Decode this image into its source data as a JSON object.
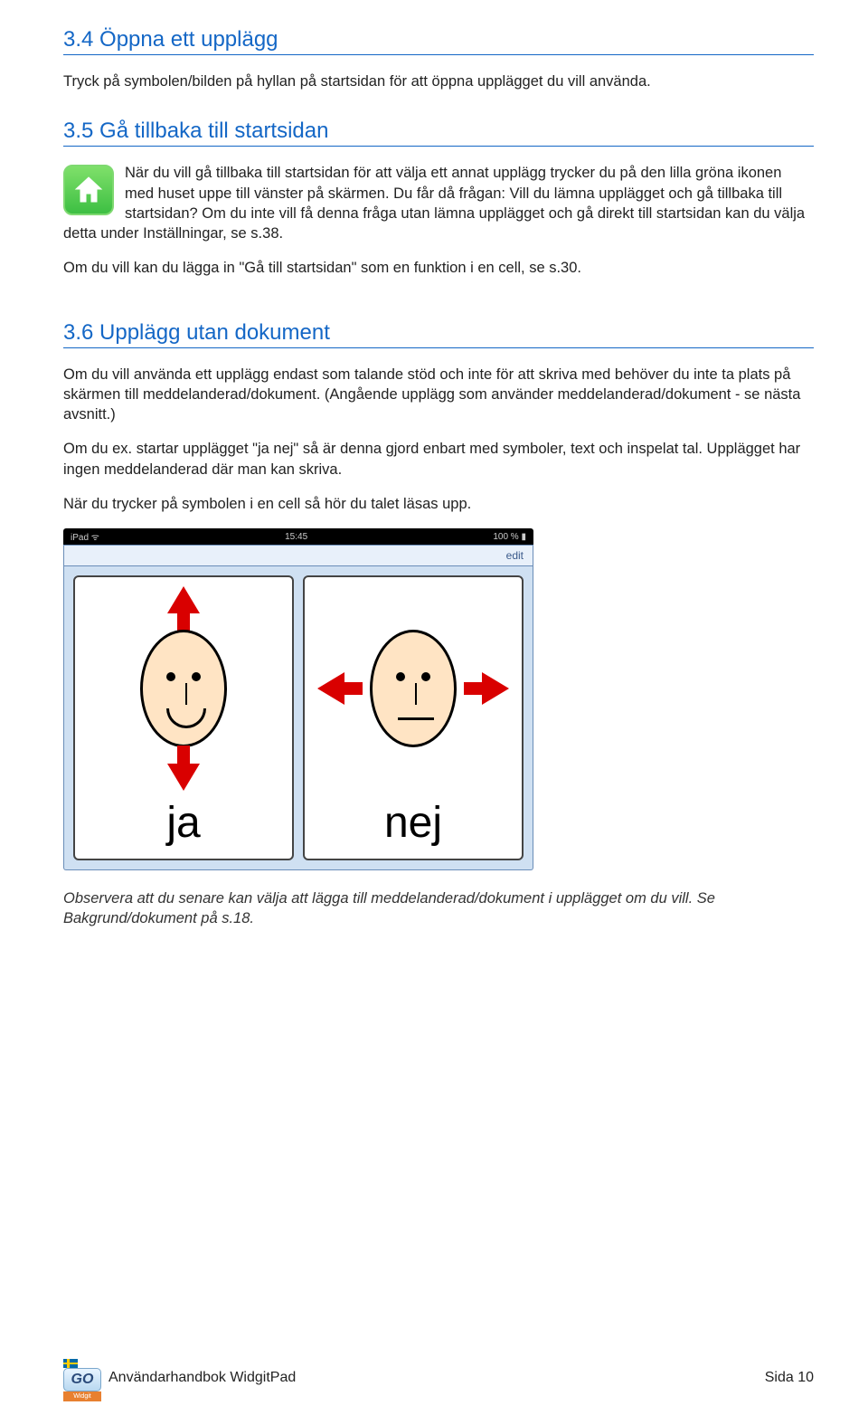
{
  "section34": {
    "heading": "3.4 Öppna ett upplägg",
    "para1": "Tryck på symbolen/bilden på hyllan på startsidan för att öppna upplägget du vill använda."
  },
  "section35": {
    "heading": "3.5 Gå tillbaka till startsidan",
    "para1": "När du vill gå tillbaka till startsidan för att välja ett annat upplägg trycker du på den lilla gröna ikonen med huset uppe till vänster på skärmen. Du får då frågan: Vill du lämna upplägget och gå tillbaka till startsidan? Om du inte vill få denna fråga utan lämna upplägget och gå direkt till startsidan kan du välja detta under Inställningar, se s.38.",
    "para2": "Om du vill kan du lägga in \"Gå till startsidan\" som en funktion i en cell, se s.30."
  },
  "section36": {
    "heading": "3.6 Upplägg utan dokument",
    "para1": "Om du vill använda ett upplägg endast som talande stöd och inte för att skriva med behöver du inte ta plats på skärmen till meddelanderad/dokument. (Angående upplägg som använder meddelanderad/dokument - se nästa avsnitt.)",
    "para2": "Om du ex. startar upplägget \"ja nej\" så är denna gjord enbart med symboler, text och inspelat tal. Upplägget har ingen meddelanderad där man kan skriva.",
    "para3": "När du trycker på symbolen i en cell så hör du talet läsas upp."
  },
  "ipad": {
    "status_left": "iPad ᯤ",
    "time": "15:45",
    "battery": "100 % ▮",
    "edit": "edit",
    "ja": "ja",
    "nej": "nej"
  },
  "note": "Observera att du senare kan välja att lägga till meddelanderad/dokument i upplägget om du vill. Se Bakgrund/dokument på s.18.",
  "footer": {
    "go": "GO",
    "widgit": "Widgit",
    "title": "Användarhandbok WidgitPad",
    "page": "Sida 10"
  }
}
